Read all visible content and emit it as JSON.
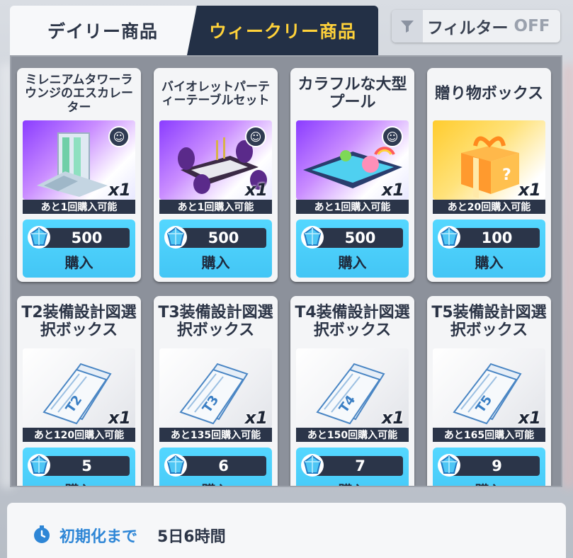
{
  "tabs": [
    {
      "label": "デイリー商品"
    },
    {
      "label": "ウィークリー商品"
    }
  ],
  "filter": {
    "label": "フィルター",
    "state": "OFF"
  },
  "items": [
    {
      "name": "ミレニアムタワーラウンジのエスカレーター",
      "qty": "x1",
      "limit": "あと1回購入可能",
      "price": "500",
      "buy_label": "購入",
      "icon": "escalator-furniture-icon"
    },
    {
      "name": "バイオレットパーティーテーブルセット",
      "qty": "x1",
      "limit": "あと1回購入可能",
      "price": "500",
      "buy_label": "購入",
      "icon": "party-table-furniture-icon"
    },
    {
      "name": "カラフルな大型プール",
      "qty": "x1",
      "limit": "あと1回購入可能",
      "price": "500",
      "buy_label": "購入",
      "icon": "pool-furniture-icon"
    },
    {
      "name": "贈り物ボックス",
      "qty": "x1",
      "limit": "あと20回購入可能",
      "price": "100",
      "buy_label": "購入",
      "icon": "gift-box-icon"
    },
    {
      "name": "T2装備設計図選択ボックス",
      "qty": "x1",
      "limit": "あと120回購入可能",
      "price": "5",
      "buy_label": "購入",
      "icon": "blueprint-icon",
      "tier": "T2"
    },
    {
      "name": "T3装備設計図選択ボックス",
      "qty": "x1",
      "limit": "あと135回購入可能",
      "price": "6",
      "buy_label": "購入",
      "icon": "blueprint-icon",
      "tier": "T3"
    },
    {
      "name": "T4装備設計図選択ボックス",
      "qty": "x1",
      "limit": "あと150回購入可能",
      "price": "7",
      "buy_label": "購入",
      "icon": "blueprint-icon",
      "tier": "T4"
    },
    {
      "name": "T5装備設計図選択ボックス",
      "qty": "x1",
      "limit": "あと165回購入可能",
      "price": "9",
      "buy_label": "購入",
      "icon": "blueprint-icon",
      "tier": "T5"
    }
  ],
  "reset": {
    "label": "初期化まで",
    "value": "5日6時間"
  },
  "colors": {
    "accent_yellow": "#ffd23a",
    "navy": "#233046",
    "buy_cyan": "#4fd2ff",
    "reset_blue": "#2e86d6"
  }
}
